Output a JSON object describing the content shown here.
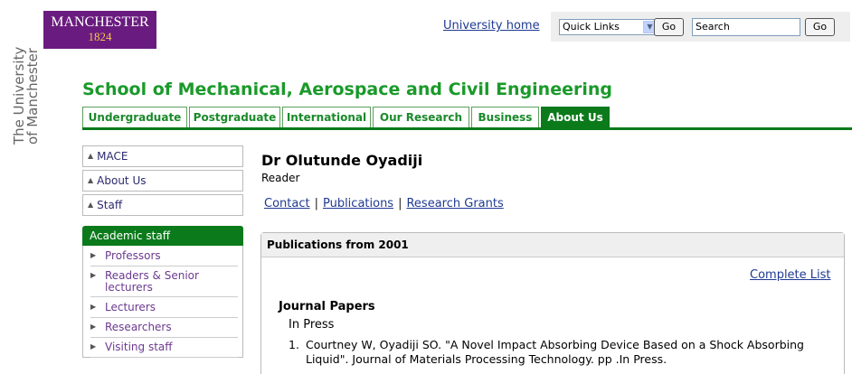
{
  "logo": {
    "name": "MANCHESTER",
    "year": "1824"
  },
  "university_vertical": [
    "The University",
    "of Manchester"
  ],
  "header": {
    "university_home": "University home",
    "quick_links": "Quick Links",
    "go_label": "Go",
    "search_value": "Search"
  },
  "school_title": "School of Mechanical, Aerospace and Civil Engineering",
  "tabs": [
    "Undergraduate",
    "Postgraduate",
    "International",
    "Our Research",
    "Business",
    "About Us"
  ],
  "active_tab": "About Us",
  "sidebar": {
    "crumbs": [
      "MACE",
      "About Us",
      "Staff"
    ],
    "section_title": "Academic staff",
    "items": [
      "Professors",
      "Readers & Senior lecturers",
      "Lecturers",
      "Researchers",
      "Visiting staff"
    ]
  },
  "person": {
    "name": "Dr Olutunde Oyadiji",
    "role": "Reader"
  },
  "subnav": [
    "Contact",
    "Publications",
    "Research Grants"
  ],
  "publications": {
    "heading": "Publications from 2001",
    "complete_list": "Complete List",
    "section": "Journal Papers",
    "status": "In Press",
    "items": [
      {
        "num": "1.",
        "text": "Courtney W, Oyadiji SO. \"A Novel Impact Absorbing Device Based on a Shock Absorbing Liquid\". Journal of Materials Processing Technology. pp .In Press."
      }
    ]
  },
  "colors": {
    "brand_purple": "#6a1b7f",
    "brand_green": "#0b7a1b",
    "title_green": "#1a9a2a",
    "link_blue": "#1f3a93"
  }
}
